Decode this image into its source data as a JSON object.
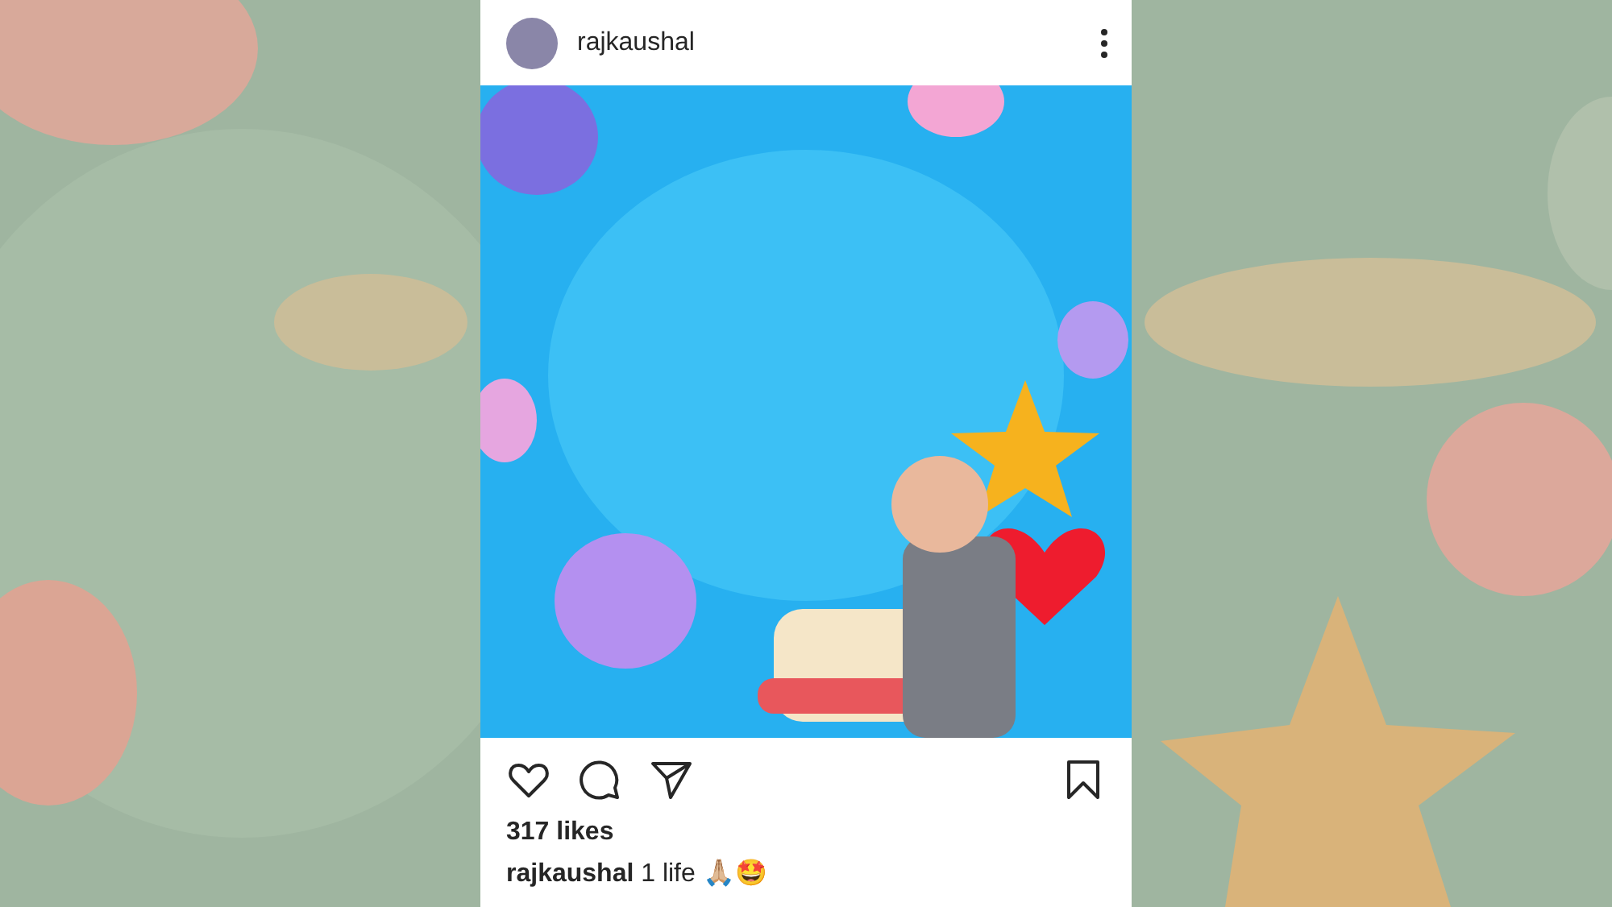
{
  "post": {
    "username": "rajkaushal",
    "likes": "317 likes",
    "caption": "**rajkaushal** 1 life 🙏🏼🤩"
  }
}
